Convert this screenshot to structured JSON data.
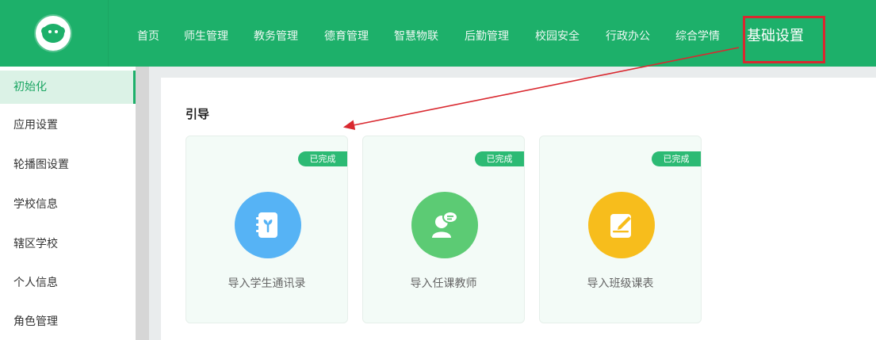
{
  "nav": {
    "items": [
      "首页",
      "师生管理",
      "教务管理",
      "德育管理",
      "智慧物联",
      "后勤管理",
      "校园安全",
      "行政办公",
      "综合学情"
    ],
    "active": "基础设置"
  },
  "sidebar": {
    "items": [
      "初始化",
      "应用设置",
      "轮播图设置",
      "学校信息",
      "辖区学校",
      "个人信息",
      "角色管理"
    ],
    "active_index": 0
  },
  "main": {
    "section_title": "引导",
    "cards": [
      {
        "label": "导入学生通讯录",
        "badge": "已完成",
        "icon": "contact-book-icon",
        "color": "#56b3f5"
      },
      {
        "label": "导入任课教师",
        "badge": "已完成",
        "icon": "teacher-icon",
        "color": "#5ccb74"
      },
      {
        "label": "导入班级课表",
        "badge": "已完成",
        "icon": "schedule-edit-icon",
        "color": "#f7bd1c"
      }
    ]
  },
  "colors": {
    "brand_green": "#1db06a",
    "highlight_red": "#d9282f",
    "annotation_arrow": "#d9282f"
  }
}
